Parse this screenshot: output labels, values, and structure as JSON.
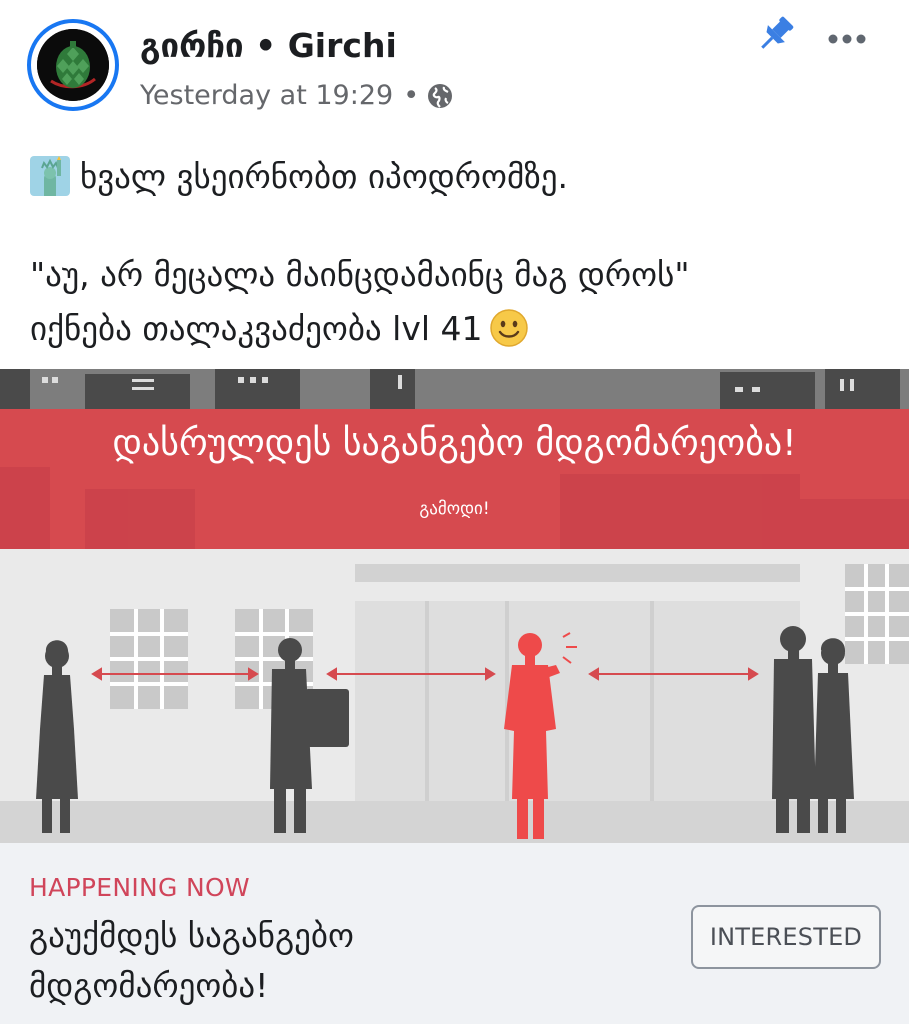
{
  "post": {
    "page_name": "გირჩი • Girchi",
    "timestamp": "Yesterday at 19:29",
    "separator": "•",
    "text_line1": "ხვალ ვსეირნობთ იპოდრომზე.",
    "text_line2": "\"აუ, არ მეცალა მაინცდამაინც მაგ დროს\"",
    "text_line3": "იქნება თალაკვაძეობა lvl 41",
    "icons": {
      "avatar": "pinecone-logo",
      "pin": "pin-icon",
      "more": "more-icon",
      "audience": "globe-icon",
      "emoji_start": "statue-of-liberty-emoji",
      "emoji_end": "smiling-face-emoji"
    }
  },
  "cover": {
    "banner_title": "დასრულდეს საგანგებო მდგომარეობა!",
    "banner_subtitle": "გამოდი!",
    "colors": {
      "banner": "#d64a4f",
      "figure_red": "#ee4a4a",
      "figure_dark": "#4a4a4a"
    }
  },
  "event": {
    "status": "HAPPENING NOW",
    "title_line1": "გაუქმდეს საგანგებო",
    "title_line2": "მდგომარეობა!",
    "interested_label": "INTERESTED"
  },
  "colors": {
    "accent": "#1877f2",
    "status": "#d0455a",
    "text": "#1c1e21",
    "secondary": "#65676b"
  }
}
